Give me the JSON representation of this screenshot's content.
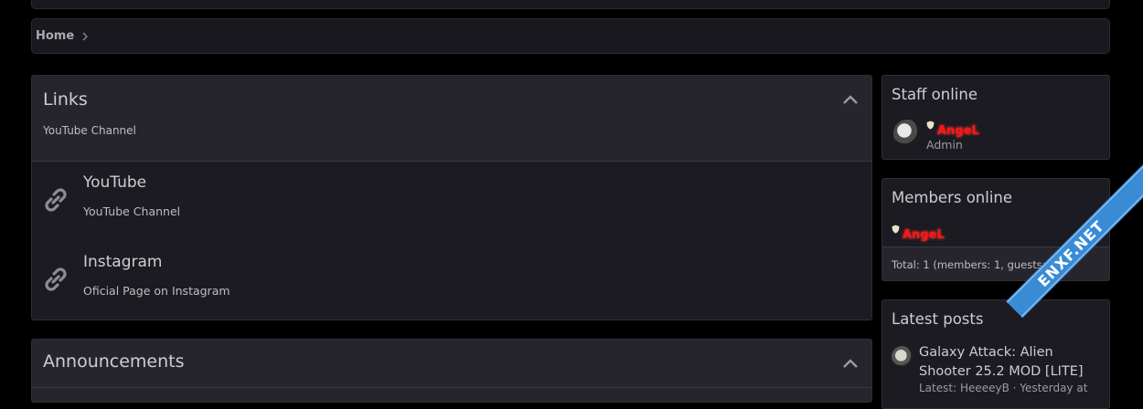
{
  "breadcrumb": {
    "home": "Home"
  },
  "links_block": {
    "title": "Links",
    "description": "YouTube Channel",
    "nodes": [
      {
        "title": "YouTube",
        "description": "YouTube Channel",
        "icon": "link-icon"
      },
      {
        "title": "Instagram",
        "description": "Oficial Page on Instagram",
        "icon": "link-icon"
      }
    ]
  },
  "announcements_block": {
    "title": "Announcements"
  },
  "staff_online": {
    "title": "Staff online",
    "member": {
      "name": "AngeL",
      "role": "Admin"
    }
  },
  "members_online": {
    "title": "Members online",
    "member": "AngeL",
    "total": "Total: 1 (members: 1, guests: 0)"
  },
  "latest_posts": {
    "title": "Latest posts",
    "post_title_line1": "Galaxy Attack: Alien",
    "post_title_line2": "Shooter 25.2 MOD [LITE]",
    "post_meta": "Latest: HeeeeyB · Yesterday at"
  },
  "watermark": {
    "text": "ENXF.NET"
  },
  "colors": {
    "background": "#000000",
    "panel": "#1c1b21",
    "header": "#26252d",
    "username": "#ff1515"
  }
}
